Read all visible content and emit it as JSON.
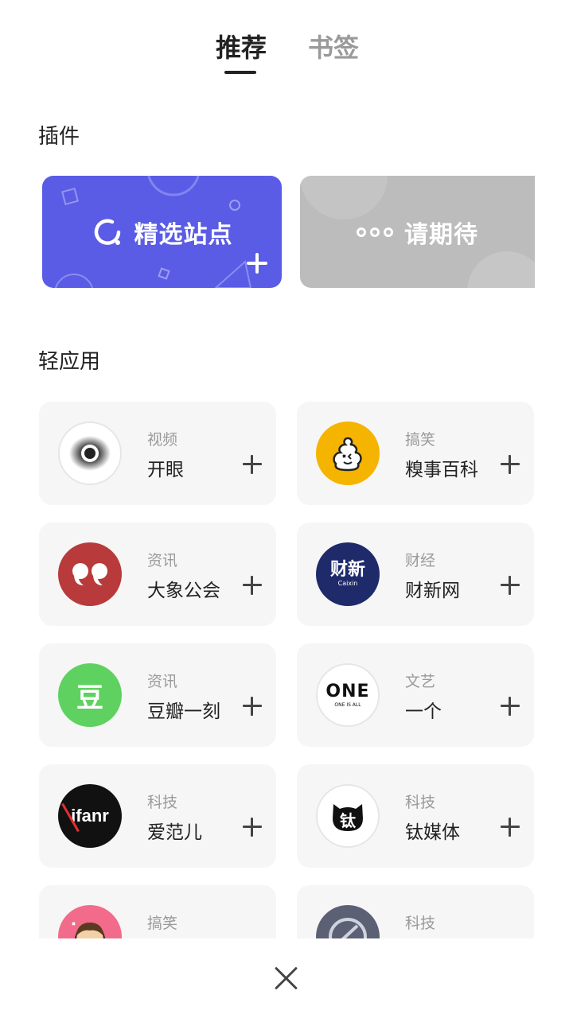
{
  "tabs": [
    {
      "label": "推荐",
      "active": true
    },
    {
      "label": "书签",
      "active": false
    }
  ],
  "sections": {
    "plugins_title": "插件",
    "lite_apps_title": "轻应用"
  },
  "plugins": [
    {
      "label": "精选站点",
      "icon": "compass-ring-icon",
      "color": "#5a5ce6"
    },
    {
      "label": "请期待",
      "icon": "three-dots-icon",
      "color": "#bcbcbc"
    }
  ],
  "apps": [
    {
      "category": "视频",
      "name": "开眼",
      "icon": "eye-icon",
      "icon_bg": "#ffffff"
    },
    {
      "category": "搞笑",
      "name": "糗事百科",
      "icon": "poop-face-icon",
      "icon_bg": "#f5b400"
    },
    {
      "category": "资讯",
      "name": "大象公会",
      "icon": "quote-marks-icon",
      "icon_bg": "#b83a3a"
    },
    {
      "category": "财经",
      "name": "财新网",
      "icon": "caixin-logo-icon",
      "icon_bg": "#1f2a6b",
      "logo_text": "财新",
      "logo_sub": "Caixin"
    },
    {
      "category": "资讯",
      "name": "豆瓣一刻",
      "icon": "douban-logo-icon",
      "icon_bg": "#5fd160",
      "logo_text": "豆"
    },
    {
      "category": "文艺",
      "name": "一个",
      "icon": "one-logo-icon",
      "icon_bg": "#ffffff",
      "logo_text": "ONE",
      "logo_sub": "ONE IS ALL"
    },
    {
      "category": "科技",
      "name": "爱范儿",
      "icon": "ifanr-logo-icon",
      "icon_bg": "#111111",
      "logo_text": "ifanr"
    },
    {
      "category": "科技",
      "name": "钛媒体",
      "icon": "tmt-cat-logo-icon",
      "icon_bg": "#ffffff",
      "logo_text": "钛"
    },
    {
      "category": "搞笑",
      "name": "",
      "icon": "cartoon-face-icon",
      "icon_bg": "#f26b8a"
    },
    {
      "category": "科技",
      "name": "",
      "icon": "tech-logo-icon",
      "icon_bg": "#5b6075"
    }
  ],
  "bottom": {
    "close_icon": "close-icon"
  }
}
